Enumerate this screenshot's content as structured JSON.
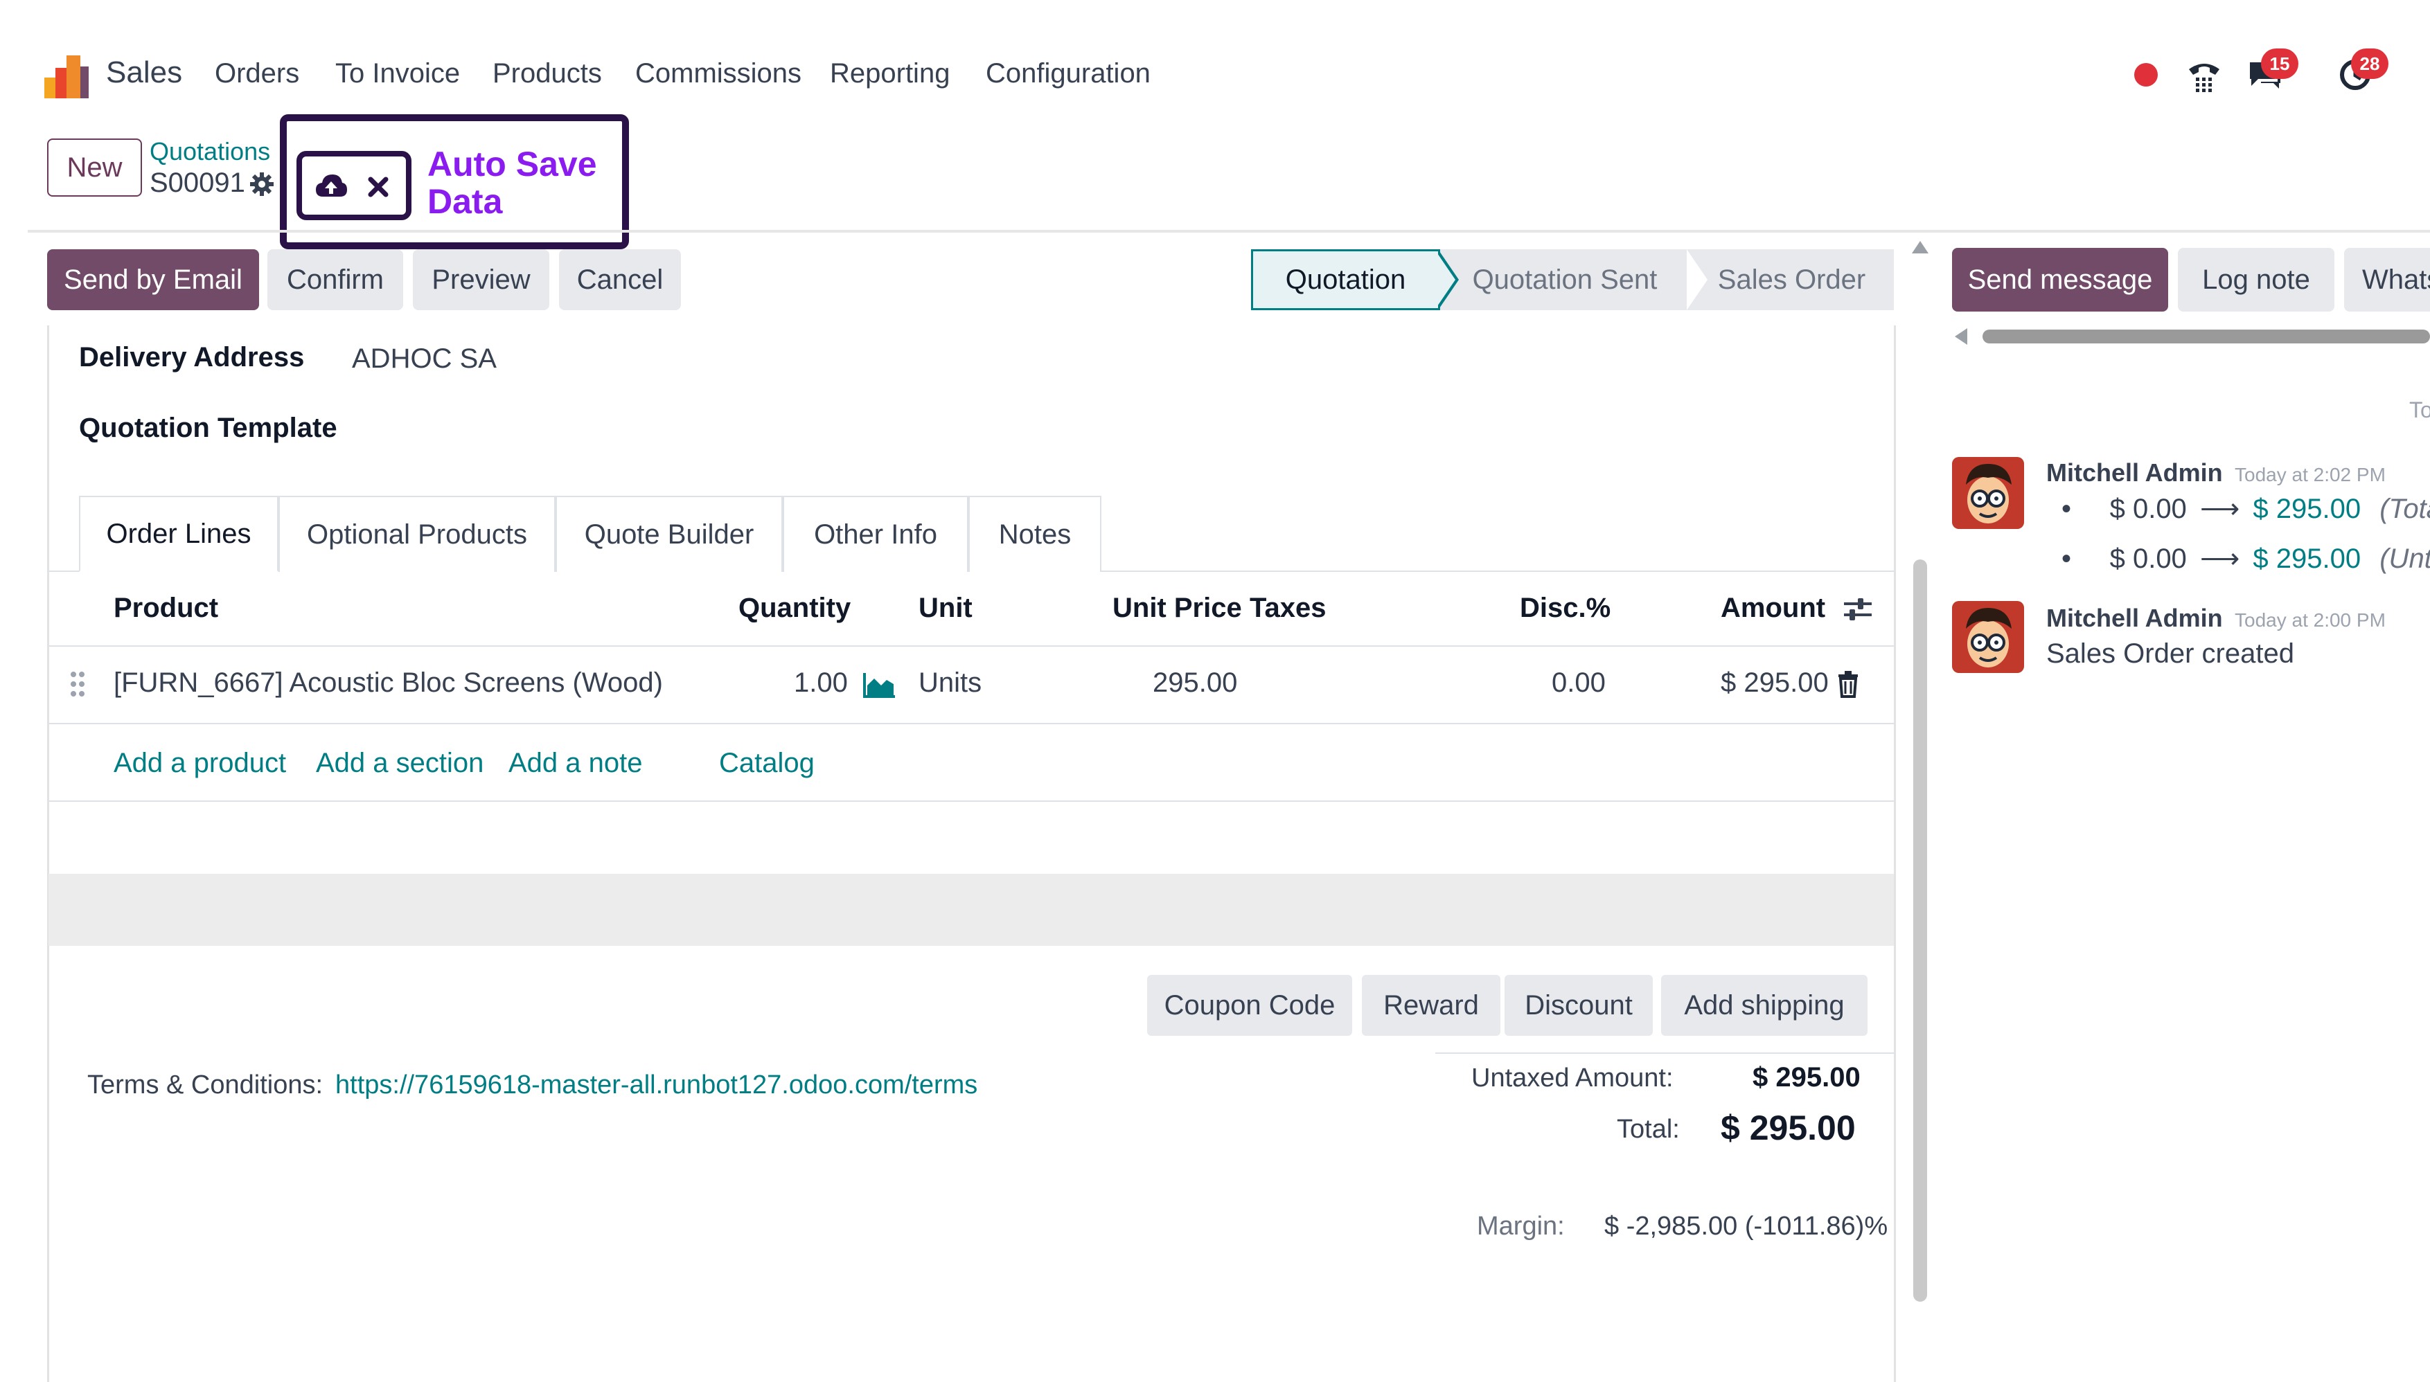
{
  "navbar": {
    "app_name": "Sales",
    "menu": [
      "Orders",
      "To Invoice",
      "Products",
      "Commissions",
      "Reporting",
      "Configuration"
    ],
    "messages_badge": "15",
    "activities_badge": "28"
  },
  "breadcrumb": {
    "new_label": "New",
    "parent": "Quotations",
    "current": "S00091"
  },
  "callout": {
    "text_line1": "Auto Save",
    "text_line2": "Data"
  },
  "actions": {
    "send_email": "Send by Email",
    "confirm": "Confirm",
    "preview": "Preview",
    "cancel": "Cancel"
  },
  "status_bar": {
    "steps": [
      "Quotation",
      "Quotation Sent",
      "Sales Order"
    ],
    "active": "Quotation"
  },
  "form": {
    "delivery_label": "Delivery Address",
    "delivery_value": "ADHOC SA",
    "template_label": "Quotation Template"
  },
  "tabs": [
    "Order Lines",
    "Optional Products",
    "Quote Builder",
    "Other Info",
    "Notes"
  ],
  "order_lines": {
    "headers": {
      "product": "Product",
      "quantity": "Quantity",
      "unit": "Unit",
      "unit_price": "Unit Price",
      "taxes": "Taxes",
      "disc": "Disc.%",
      "amount": "Amount"
    },
    "rows": [
      {
        "product": "[FURN_6667] Acoustic Bloc Screens (Wood)",
        "quantity": "1.00",
        "unit": "Units",
        "unit_price": "295.00",
        "taxes": "",
        "disc": "0.00",
        "amount": "$ 295.00"
      }
    ],
    "add_product": "Add a product",
    "add_section": "Add a section",
    "add_note": "Add a note",
    "catalog": "Catalog"
  },
  "promo_buttons": {
    "coupon": "Coupon Code",
    "reward": "Reward",
    "discount": "Discount",
    "shipping": "Add shipping"
  },
  "terms": {
    "label": "Terms & Conditions:",
    "link": "https://76159618-master-all.runbot127.odoo.com/terms"
  },
  "totals": {
    "untaxed_label": "Untaxed Amount:",
    "untaxed_value": "$ 295.00",
    "total_label": "Total:",
    "total_value": "$ 295.00",
    "margin_label": "Margin:",
    "margin_value": "$ -2,985.00 (-1011.86)%"
  },
  "chatter": {
    "send_message": "Send message",
    "log_note": "Log note",
    "whatsapp": "Whats",
    "today_marker": "To",
    "messages": [
      {
        "author": "Mitchell Admin",
        "time": "Today at 2:02 PM",
        "changes": [
          {
            "old": "$ 0.00",
            "new": "$ 295.00",
            "field": "(Total)"
          },
          {
            "old": "$ 0.00",
            "new": "$ 295.00",
            "field": "(Untaxed"
          }
        ]
      },
      {
        "author": "Mitchell Admin",
        "time": "Today at 2:00 PM",
        "body": "Sales Order created"
      }
    ]
  },
  "colors": {
    "brand": "#714b67",
    "accent": "#017e84",
    "callout": "#8b1cf0",
    "badge": "#e0313a"
  }
}
